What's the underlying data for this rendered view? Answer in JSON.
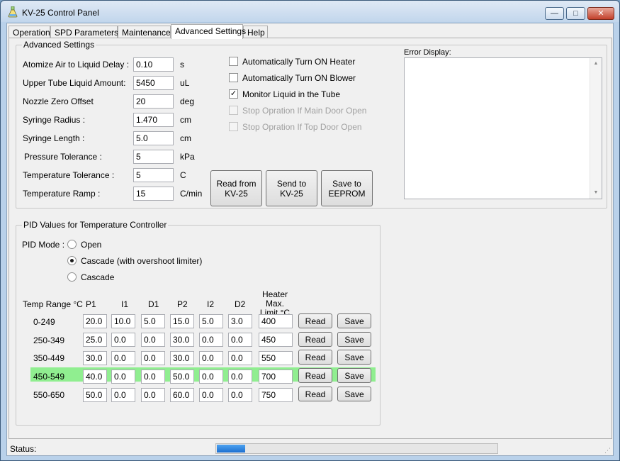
{
  "window": {
    "title": "KV-25 Control Panel",
    "buttons": {
      "minimize": "—",
      "maximize": "□",
      "close": "✕"
    }
  },
  "tabs": [
    {
      "label": "Operation",
      "active": false
    },
    {
      "label": "SPD Parameters",
      "active": false
    },
    {
      "label": "Maintenance",
      "active": false
    },
    {
      "label": "Advanced Settings",
      "active": true
    },
    {
      "label": "Help",
      "active": false
    }
  ],
  "advanced": {
    "legend": "Advanced Settings",
    "fields": [
      {
        "label": "Atomize Air to Liquid Delay :",
        "value": "0.10",
        "unit": "s"
      },
      {
        "label": "Upper Tube Liquid Amount:",
        "value": "5450",
        "unit": "uL"
      },
      {
        "label": "Nozzle Zero Offset",
        "value": "20",
        "unit": "deg"
      },
      {
        "label": "Syringe Radius :",
        "value": "1.470",
        "unit": "cm"
      },
      {
        "label": "Syringe  Length :",
        "value": "5.0",
        "unit": "cm"
      },
      {
        "label": "Pressure Tolerance :",
        "value": "5",
        "unit": "kPa"
      },
      {
        "label": "Temperature Tolerance :",
        "value": "5",
        "unit": "C"
      },
      {
        "label": "Temperature Ramp :",
        "value": "15",
        "unit": "C/min"
      }
    ],
    "checkboxes": [
      {
        "label": "Automatically Turn ON Heater",
        "checked": false,
        "enabled": true
      },
      {
        "label": "Automatically Turn ON Blower",
        "checked": false,
        "enabled": true
      },
      {
        "label": "Monitor Liquid in the Tube",
        "checked": true,
        "enabled": true
      },
      {
        "label": "Stop Opration If Main Door Open",
        "checked": false,
        "enabled": false
      },
      {
        "label": "Stop Opration If Top Door Open",
        "checked": false,
        "enabled": false
      }
    ],
    "buttons": {
      "read": "Read from\nKV-25",
      "send": "Send  to\nKV-25",
      "save": "Save to\nEEPROM"
    }
  },
  "error_display": {
    "label": "Error Display:",
    "content": ""
  },
  "pid": {
    "legend": "PID Values for Temperature Controller",
    "mode_label": "PID Mode :",
    "modes": [
      {
        "label": "Open",
        "selected": false
      },
      {
        "label": "Cascade (with overshoot limiter)",
        "selected": true
      },
      {
        "label": "Cascade",
        "selected": false
      }
    ],
    "headers": {
      "range": "Temp Range °C",
      "p1": "P1",
      "i1": "I1",
      "d1": "D1",
      "p2": "P2",
      "i2": "I2",
      "d2": "D2",
      "heater_max": "Heater Max.\nLimit °C"
    },
    "row_buttons": {
      "read": "Read",
      "save": "Save"
    },
    "highlight_color": "#90ee90",
    "rows": [
      {
        "range": "0-249",
        "p1": "20.0",
        "i1": "10.0",
        "d1": "5.0",
        "p2": "15.0",
        "i2": "5.0",
        "d2": "3.0",
        "max": "400",
        "highlighted": false
      },
      {
        "range": "250-349",
        "p1": "25.0",
        "i1": "0.0",
        "d1": "0.0",
        "p2": "30.0",
        "i2": "0.0",
        "d2": "0.0",
        "max": "450",
        "highlighted": false
      },
      {
        "range": "350-449",
        "p1": "30.0",
        "i1": "0.0",
        "d1": "0.0",
        "p2": "30.0",
        "i2": "0.0",
        "d2": "0.0",
        "max": "550",
        "highlighted": false
      },
      {
        "range": "450-549",
        "p1": "40.0",
        "i1": "0.0",
        "d1": "0.0",
        "p2": "50.0",
        "i2": "0.0",
        "d2": "0.0",
        "max": "700",
        "highlighted": true
      },
      {
        "range": "550-650",
        "p1": "50.0",
        "i1": "0.0",
        "d1": "0.0",
        "p2": "60.0",
        "i2": "0.0",
        "d2": "0.0",
        "max": "750",
        "highlighted": false
      }
    ]
  },
  "status": {
    "label": "Status:",
    "progress_fraction": 0.1
  }
}
